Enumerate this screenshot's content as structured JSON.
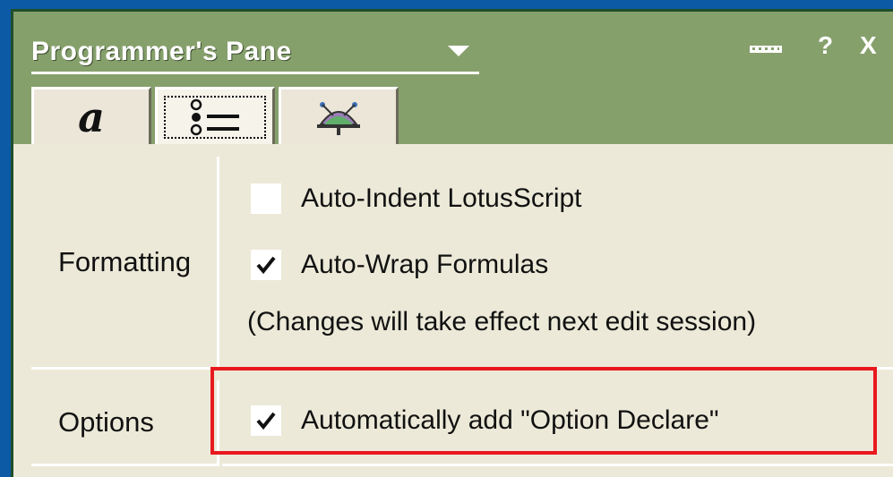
{
  "window": {
    "title": "Programmer's Pane",
    "help_label": "?",
    "close_label": "X"
  },
  "tabs": [
    {
      "name": "fonts",
      "glyph": "a",
      "active": false
    },
    {
      "name": "options",
      "active": true
    },
    {
      "name": "tools",
      "active": false
    }
  ],
  "formatting": {
    "label": "Formatting",
    "auto_indent_label": "Auto-Indent LotusScript",
    "auto_indent_checked": false,
    "auto_wrap_label": "Auto-Wrap Formulas",
    "auto_wrap_checked": true,
    "note": "(Changes will take effect next edit session)"
  },
  "options": {
    "label": "Options",
    "option_declare_label": "Automatically add \"Option Declare\"",
    "option_declare_checked": true
  },
  "colors": {
    "titlebar": "#86a06c",
    "panel": "#ece9d8",
    "highlight": "#e8191e",
    "desktop": "#0c5aa6"
  }
}
